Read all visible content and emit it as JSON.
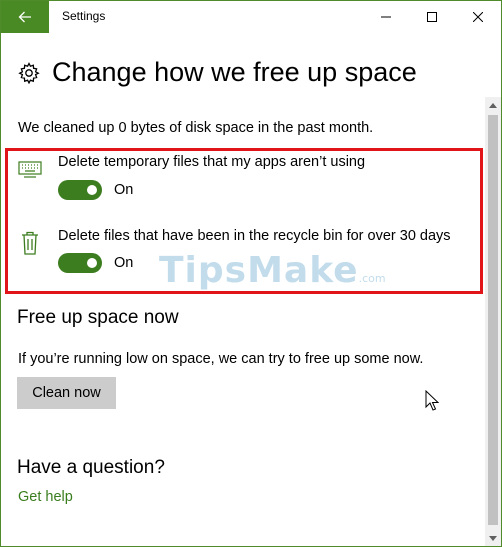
{
  "window": {
    "title": "Settings",
    "accent_color": "#4a8a24"
  },
  "titlebar": {
    "back_icon": "back-arrow-icon",
    "controls": [
      "minimize-icon",
      "maximize-icon",
      "close-icon"
    ]
  },
  "page": {
    "icon": "gear-icon",
    "title": "Change how we free up space"
  },
  "summary": "We cleaned up 0 bytes of disk space in the past month.",
  "options": [
    {
      "icon": "keyboard-icon",
      "label": "Delete temporary files that my apps aren’t using",
      "toggle_on": true,
      "state_label": "On"
    },
    {
      "icon": "trash-icon",
      "label": "Delete files that have been in the recycle bin for over 30 days",
      "toggle_on": true,
      "state_label": "On"
    }
  ],
  "highlight_color": "#e01419",
  "watermark": {
    "text": "TipsMake",
    "suffix": ".com"
  },
  "free_up": {
    "heading": "Free up space now",
    "description": "If you’re running low on space, we can try to free up some now.",
    "button_label": "Clean now"
  },
  "question": {
    "heading": "Have a question?",
    "link_label": "Get help",
    "link_color": "#3a7d1e"
  }
}
